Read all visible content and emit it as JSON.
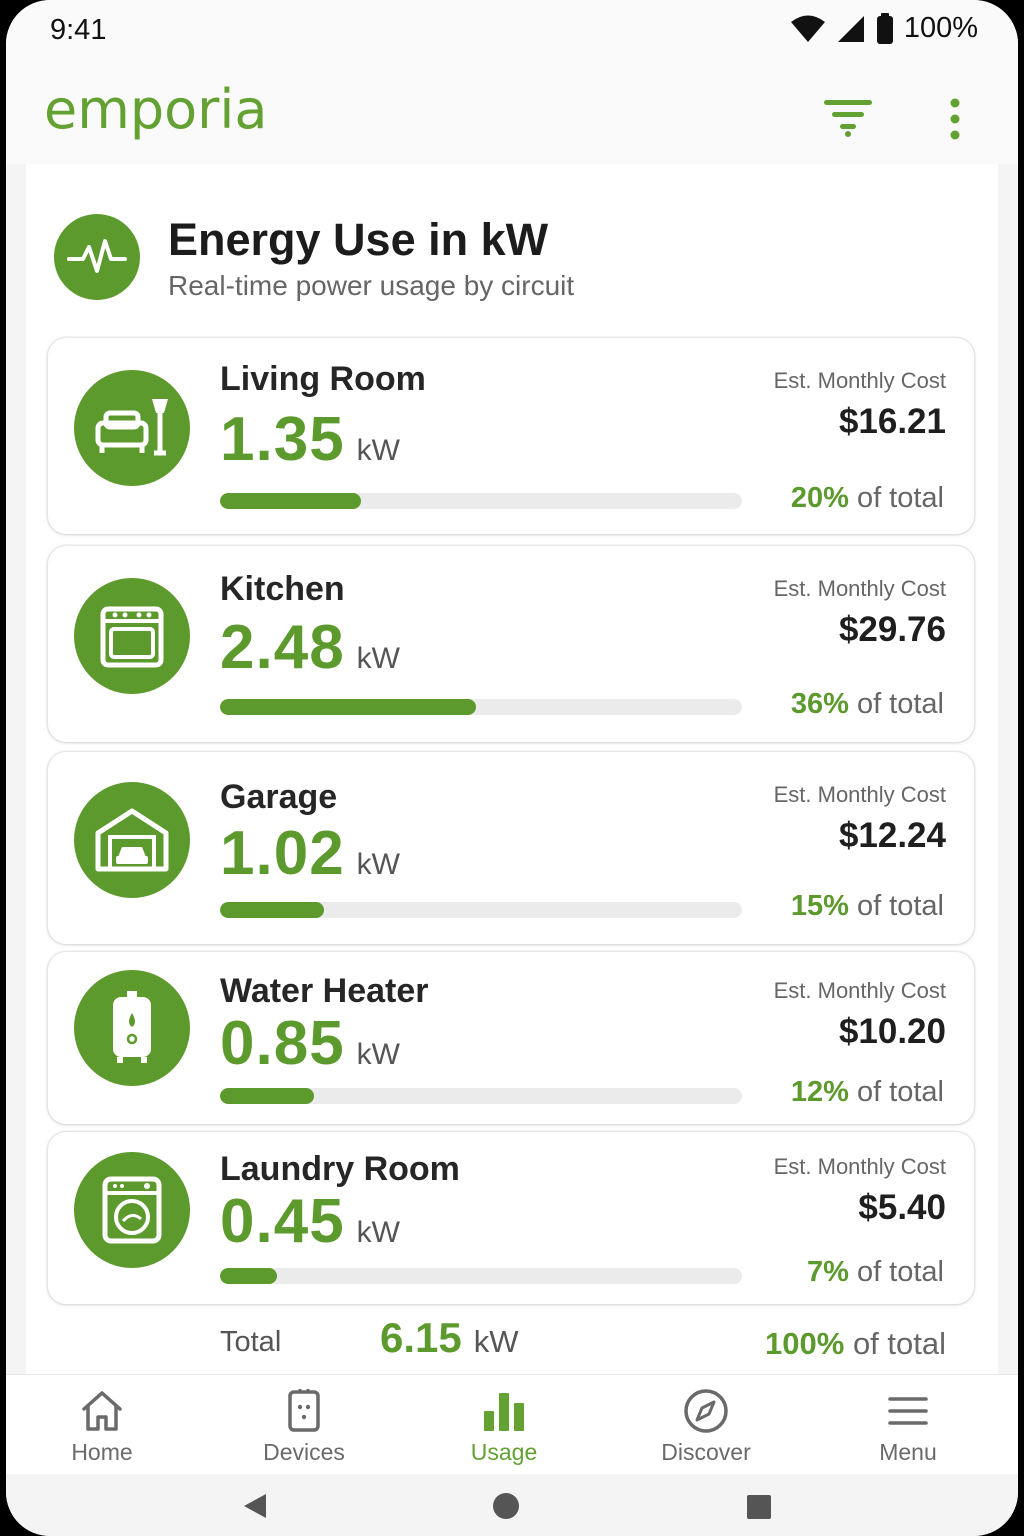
{
  "status": {
    "time": "9:41",
    "battery": "100%"
  },
  "app": {
    "logo": "emporia",
    "brand_color": "#5d9a2e"
  },
  "header": {
    "title": "Energy Use in kW",
    "subtitle": "Real-time power usage by circuit"
  },
  "circuits": [
    {
      "name": "Living Room",
      "kw": "1.35",
      "unit": "kW",
      "cost_label": "Est. Monthly Cost",
      "cost": "$16.21",
      "pct": "20%",
      "pct_suffix": "of total",
      "usage_fraction": 0.27,
      "icon": "sofa-lamp-icon"
    },
    {
      "name": "Kitchen",
      "kw": "2.48",
      "unit": "kW",
      "cost_label": "Est. Monthly Cost",
      "cost": "$29.76",
      "pct": "36%",
      "pct_suffix": "of total",
      "usage_fraction": 0.49,
      "icon": "stove-icon"
    },
    {
      "name": "Garage",
      "kw": "1.02",
      "unit": "kW",
      "cost_label": "Est. Monthly Cost",
      "cost": "$12.24",
      "pct": "15%",
      "pct_suffix": "of total",
      "usage_fraction": 0.2,
      "icon": "garage-icon"
    },
    {
      "name": "Water Heater",
      "kw": "0.85",
      "unit": "kW",
      "cost_label": "Est. Monthly Cost",
      "cost": "$10.20",
      "pct": "12%",
      "pct_suffix": "of total",
      "usage_fraction": 0.18,
      "icon": "water-heater-icon"
    },
    {
      "name": "Laundry Room",
      "kw": "0.45",
      "unit": "kW",
      "cost_label": "Est. Monthly Cost",
      "cost": "$5.40",
      "pct": "7%",
      "pct_suffix": "of total",
      "usage_fraction": 0.11,
      "icon": "washing-machine-icon"
    }
  ],
  "total": {
    "label": "Total",
    "kw": "6.15",
    "unit": "kW",
    "pct": "100%",
    "pct_suffix": "of total"
  },
  "nav": [
    {
      "label": "Home",
      "icon": "home-icon",
      "active": false
    },
    {
      "label": "Devices",
      "icon": "devices-icon",
      "active": false
    },
    {
      "label": "Usage",
      "icon": "usage-bars-icon",
      "active": true
    },
    {
      "label": "Discover",
      "icon": "compass-icon",
      "active": false
    },
    {
      "label": "Menu",
      "icon": "menu-icon",
      "active": false
    }
  ]
}
